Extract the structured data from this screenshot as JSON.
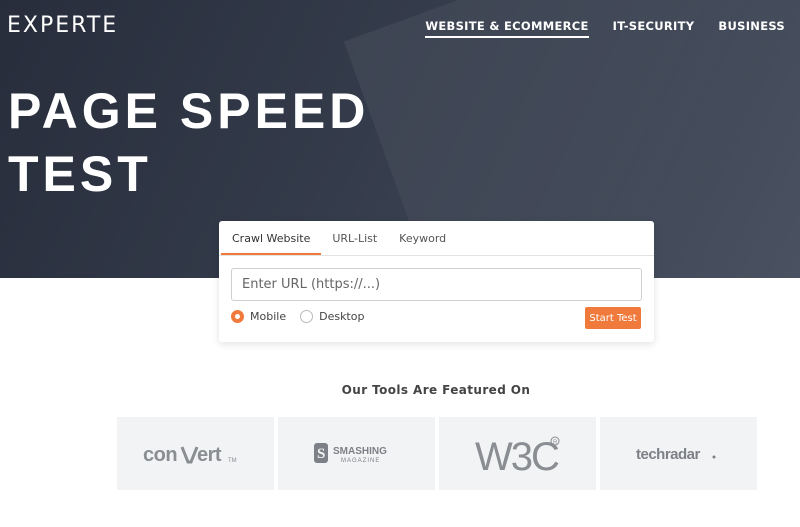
{
  "header": {
    "logo": "EXPERTE",
    "nav": [
      {
        "label": "WEBSITE & ECOMMERCE",
        "active": true
      },
      {
        "label": "IT-SECURITY",
        "active": false
      },
      {
        "label": "BUSINESS",
        "active": false
      }
    ]
  },
  "hero": {
    "title_line1": "PAGE SPEED",
    "title_line2": "TEST"
  },
  "form": {
    "tabs": [
      {
        "label": "Crawl Website",
        "active": true
      },
      {
        "label": "URL-List",
        "active": false
      },
      {
        "label": "Keyword",
        "active": false
      }
    ],
    "url_placeholder": "Enter URL (https://...)",
    "url_value": "",
    "options": [
      {
        "label": "Mobile",
        "checked": true
      },
      {
        "label": "Desktop",
        "checked": false
      }
    ],
    "submit_label": "Start Test"
  },
  "featured": {
    "heading": "Our Tools Are Featured On",
    "logos": [
      {
        "name": "convert",
        "text": "convert"
      },
      {
        "name": "smashing-magazine",
        "text": "SMASHING",
        "subtext": "MAGAZINE"
      },
      {
        "name": "w3c",
        "text": "W3C"
      },
      {
        "name": "techradar",
        "text": "techradar"
      }
    ]
  },
  "colors": {
    "accent": "#f07a3c",
    "hero_dark": "#272d3b",
    "logo_box_bg": "#f2f3f5"
  }
}
